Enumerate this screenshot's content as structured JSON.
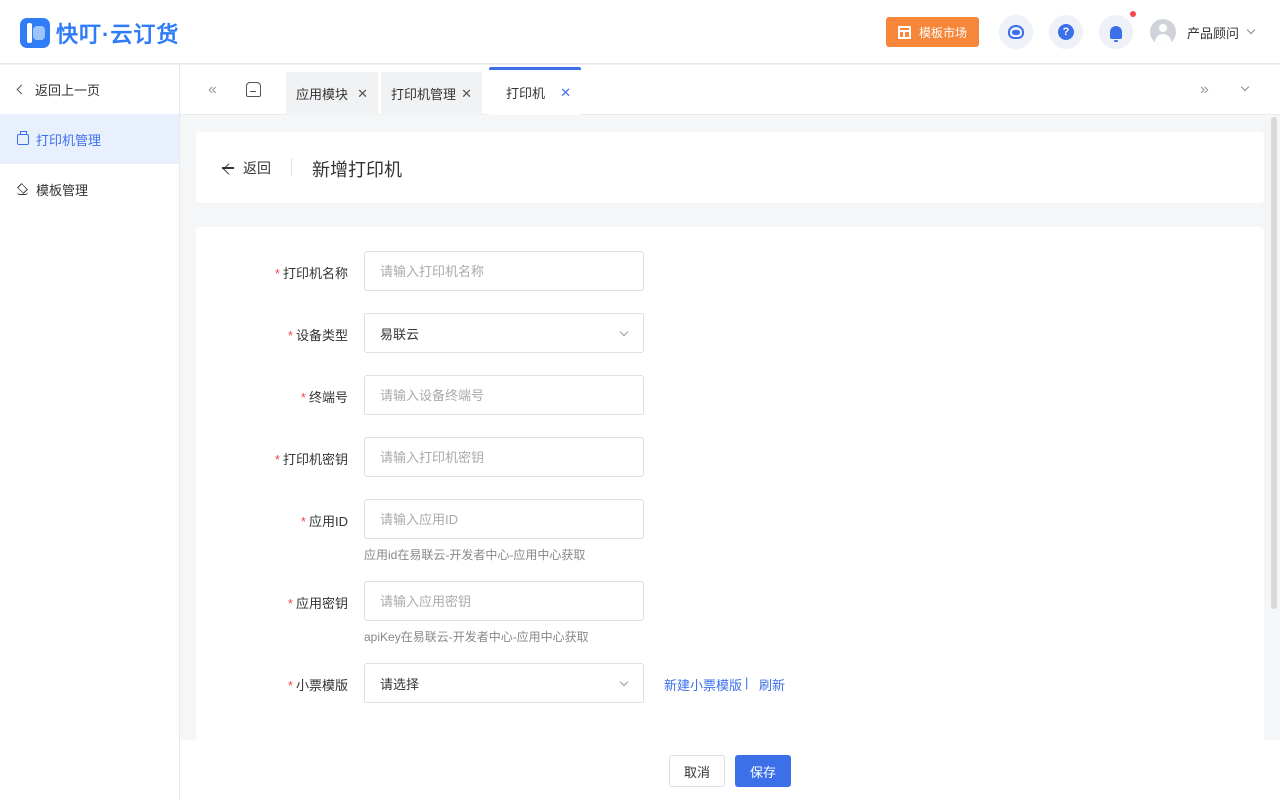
{
  "header": {
    "brand": "快叮·云订货",
    "market_button": "模板市场",
    "user_name": "产品顾问",
    "help_glyph": "?"
  },
  "sidebar": {
    "back_label": "返回上一页",
    "items": [
      {
        "label": "打印机管理",
        "icon": "printer-icon",
        "active": true
      },
      {
        "label": "模板管理",
        "icon": "layers-icon",
        "active": false
      }
    ]
  },
  "tabs": [
    {
      "label": "应用模块",
      "active": false
    },
    {
      "label": "打印机管理",
      "active": false
    },
    {
      "label": "打印机",
      "active": true
    }
  ],
  "page": {
    "back_label": "返回",
    "title": "新增打印机"
  },
  "form": {
    "printer_name": {
      "label": "打印机名称",
      "placeholder": "请输入打印机名称",
      "value": ""
    },
    "device_type": {
      "label": "设备类型",
      "value": "易联云"
    },
    "terminal_no": {
      "label": "终端号",
      "placeholder": "请输入设备终端号",
      "value": ""
    },
    "printer_secret": {
      "label": "打印机密钥",
      "placeholder": "请输入打印机密钥",
      "value": ""
    },
    "app_id": {
      "label": "应用ID",
      "placeholder": "请输入应用ID",
      "value": "",
      "hint": "应用id在易联云-开发者中心-应用中心获取"
    },
    "app_secret": {
      "label": "应用密钥",
      "placeholder": "请输入应用密钥",
      "value": "",
      "hint": "apiKey在易联云-开发者中心-应用中心获取"
    },
    "receipt_template": {
      "label": "小票模版",
      "value": "请选择",
      "new_link": "新建小票模版",
      "separator": "|",
      "refresh_link": "刷新"
    }
  },
  "footer": {
    "cancel_label": "取消",
    "save_label": "保存"
  },
  "colors": {
    "primary": "#3b70e8",
    "brand": "#2f7cf6",
    "market": "#f5863a",
    "required": "#f04a4a"
  }
}
